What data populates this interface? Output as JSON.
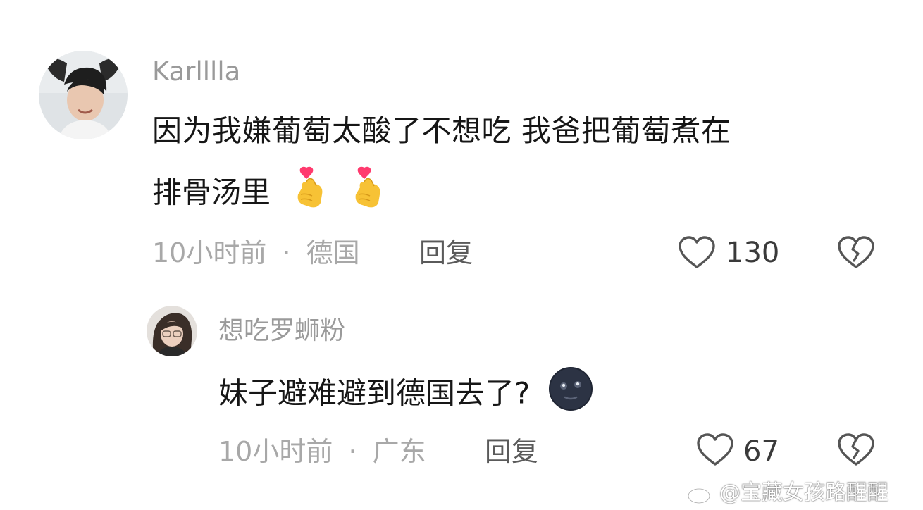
{
  "comments": [
    {
      "username": "Karlllla",
      "text_line1": "因为我嫌葡萄太酸了不想吃  我爸把葡萄煮在",
      "text_line2": "排骨汤里",
      "emojis": [
        "finger-heart-emoji",
        "finger-heart-emoji"
      ],
      "time": "10小时前",
      "separator": "·",
      "location": "德国",
      "reply_label": "回复",
      "like_count": "130"
    },
    {
      "username": "想吃罗蛳粉",
      "text": "妹子避难避到德国去了?",
      "emojis": [
        "new-moon-face-emoji"
      ],
      "time": "10小时前",
      "separator": "·",
      "location": "广东",
      "reply_label": "回复",
      "like_count": "67"
    }
  ],
  "watermark": {
    "text": "@宝藏女孩路醒醒",
    "icon": "weibo-logo-icon"
  },
  "icons": {
    "like": "heart-outline-icon",
    "dislike": "broken-heart-icon"
  },
  "colors": {
    "background": "#ffffff",
    "username": "#9a9a9a",
    "content": "#161616",
    "meta": "#a8a8a8",
    "reply": "#5a5a5a",
    "count": "#3a3a3a"
  }
}
